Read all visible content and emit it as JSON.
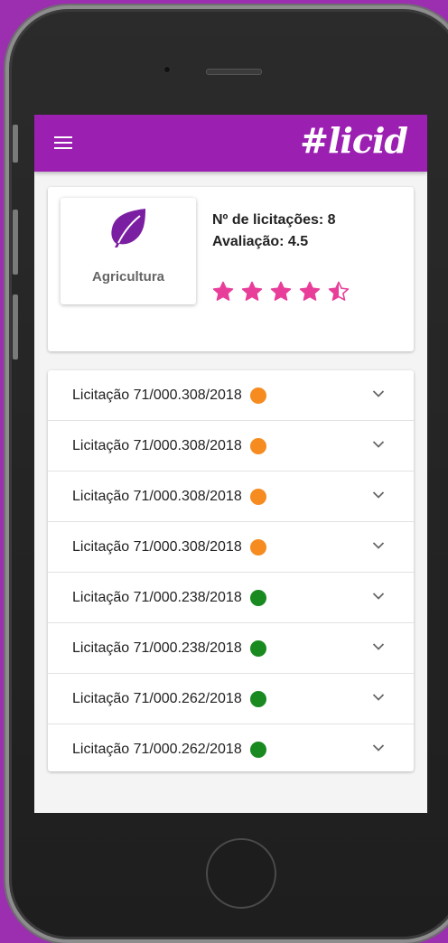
{
  "app": {
    "brand": "#licid"
  },
  "category": {
    "name": "Agricultura"
  },
  "stats": {
    "count_text": "Nº de licitações: 8",
    "rating_text": "Avaliação: 4.5",
    "rating_value": 4.5,
    "rating_max": 5
  },
  "colors": {
    "primary": "#9b1fb1",
    "star": "#e83e9a",
    "status_orange": "#f68b1f",
    "status_green": "#188a1f"
  },
  "licitacoes": [
    {
      "label": "Licitação 71/000.308/2018",
      "status": "orange"
    },
    {
      "label": "Licitação 71/000.308/2018",
      "status": "orange"
    },
    {
      "label": "Licitação 71/000.308/2018",
      "status": "orange"
    },
    {
      "label": "Licitação 71/000.308/2018",
      "status": "orange"
    },
    {
      "label": "Licitação 71/000.238/2018",
      "status": "green"
    },
    {
      "label": "Licitação 71/000.238/2018",
      "status": "green"
    },
    {
      "label": "Licitação 71/000.262/2018",
      "status": "green"
    },
    {
      "label": "Licitação 71/000.262/2018",
      "status": "green"
    }
  ],
  "icons": {
    "menu": "menu-icon",
    "category": "leaf-icon",
    "rating": "star-icon",
    "expand": "chevron-down-icon"
  }
}
